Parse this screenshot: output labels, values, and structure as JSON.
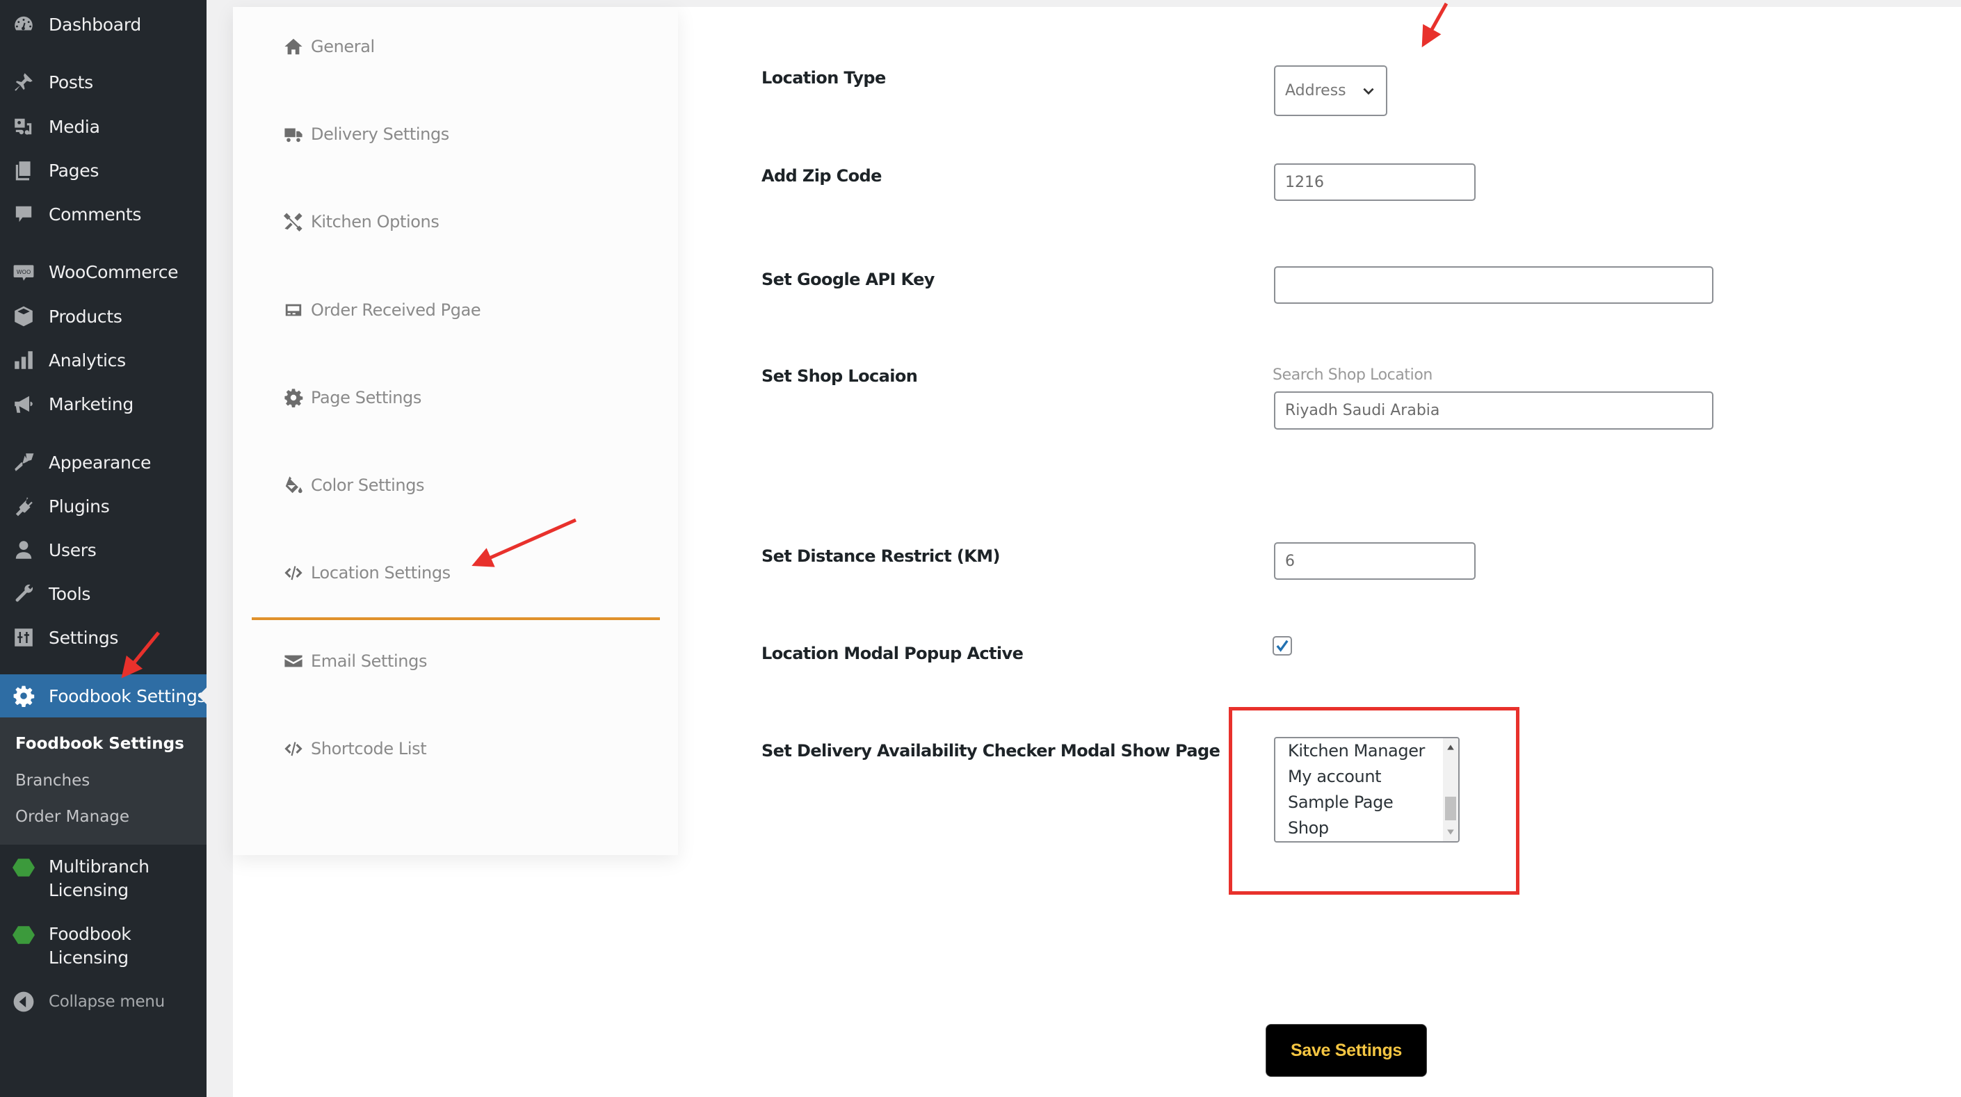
{
  "sidebar": {
    "items": [
      {
        "label": "Dashboard",
        "icon": "dashboard-icon"
      },
      {
        "label": "Posts",
        "icon": "pin-icon"
      },
      {
        "label": "Media",
        "icon": "media-icon"
      },
      {
        "label": "Pages",
        "icon": "pages-icon"
      },
      {
        "label": "Comments",
        "icon": "comment-icon"
      },
      {
        "label": "WooCommerce",
        "icon": "woocommerce-icon"
      },
      {
        "label": "Products",
        "icon": "box-icon"
      },
      {
        "label": "Analytics",
        "icon": "bar-chart-icon"
      },
      {
        "label": "Marketing",
        "icon": "megaphone-icon"
      },
      {
        "label": "Appearance",
        "icon": "paintbrush-icon"
      },
      {
        "label": "Plugins",
        "icon": "plug-icon"
      },
      {
        "label": "Users",
        "icon": "user-icon"
      },
      {
        "label": "Tools",
        "icon": "wrench-icon"
      },
      {
        "label": "Settings",
        "icon": "sliders-icon"
      },
      {
        "label": "Foodbook Settings",
        "icon": "gear-icon",
        "active": true
      }
    ],
    "submenu": [
      {
        "label": "Foodbook Settings",
        "current": true
      },
      {
        "label": "Branches"
      },
      {
        "label": "Order Manage"
      }
    ],
    "licensing": [
      {
        "line1": "Multibranch",
        "line2": "Licensing",
        "icon": "hexagon-logo-icon"
      },
      {
        "line1": "Foodbook",
        "line2": "Licensing",
        "icon": "hexagon-logo-icon"
      }
    ],
    "collapse_label": "Collapse menu"
  },
  "tabs": [
    {
      "label": "General",
      "icon": "home-icon"
    },
    {
      "label": "Delivery Settings",
      "icon": "truck-icon"
    },
    {
      "label": "Kitchen Options",
      "icon": "tools-icon"
    },
    {
      "label": "Order Received Pgae",
      "icon": "receipt-icon"
    },
    {
      "label": "Page Settings",
      "icon": "gear-icon"
    },
    {
      "label": "Color Settings",
      "icon": "paint-bucket-icon"
    },
    {
      "label": "Location Settings",
      "icon": "code-icon",
      "active": true
    },
    {
      "label": "Email Settings",
      "icon": "envelope-icon"
    },
    {
      "label": "Shortcode List",
      "icon": "code-icon"
    }
  ],
  "form": {
    "location_type": {
      "label": "Location Type",
      "value": "Address"
    },
    "zip_code": {
      "label": "Add Zip Code",
      "value": "1216"
    },
    "google_api_key": {
      "label": "Set Google API Key",
      "value": ""
    },
    "shop_location": {
      "label": "Set Shop Locaion",
      "caption": "Search Shop Location",
      "value": "Riyadh Saudi Arabia"
    },
    "distance_restrict": {
      "label": "Set Distance Restrict (KM)",
      "value": "6"
    },
    "modal_popup_active": {
      "label": "Location Modal Popup Active",
      "checked": true
    },
    "checker_show_page": {
      "label": "Set Delivery Availability Checker Modal Show Page",
      "options": [
        "Kitchen Manager",
        "My account",
        "Sample Page",
        "Shop"
      ]
    }
  },
  "save_button": {
    "label": "Save Settings"
  },
  "colors": {
    "sidebar_bg": "#23282d",
    "active_menu": "#2e6da4",
    "active_tab_underline": "#e0912c",
    "save_button_text": "#f4c542",
    "annotation_red": "#e8312c",
    "checkbox_check": "#2271b1"
  }
}
